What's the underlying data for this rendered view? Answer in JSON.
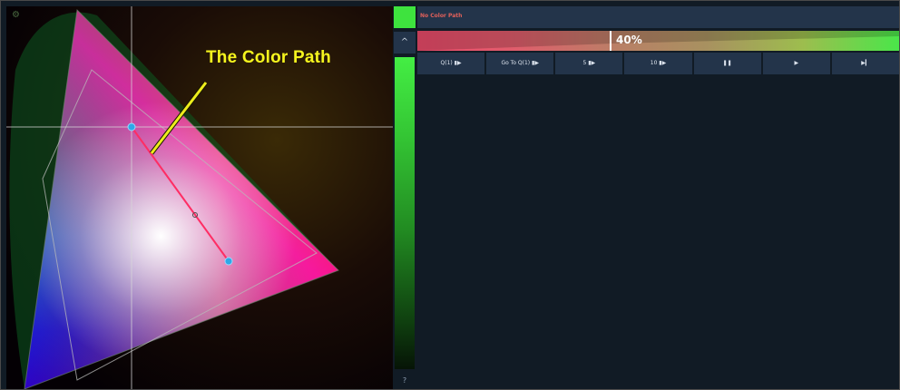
{
  "annotation": {
    "label": "The Color Path"
  },
  "color_path": {
    "title": "No Color Path",
    "progress_label": "40%",
    "progress": 0.4,
    "start_color": "#ef4c6c",
    "end_color": "#4ae64a"
  },
  "rail": {
    "swatch_color": "#3ee33e",
    "collapse_icon": "^",
    "help_icon": "?"
  },
  "transport": [
    {
      "label": "Q(1) ▮▶"
    },
    {
      "label": "Go To Q(1) ▮▶"
    },
    {
      "label": "5 ▮▶"
    },
    {
      "label": "10 ▮▶"
    },
    {
      "label": "❚❚"
    },
    {
      "label": "▶"
    },
    {
      "label": "▶▎"
    }
  ],
  "gear_icon": "⚙"
}
